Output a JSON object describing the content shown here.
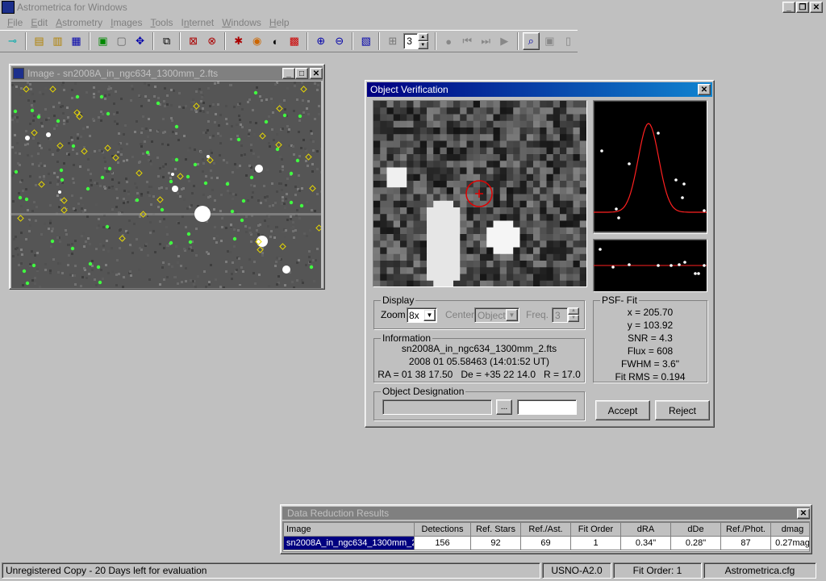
{
  "app": {
    "title": "Astrometrica for Windows"
  },
  "menu": [
    {
      "label": "File",
      "key": "F"
    },
    {
      "label": "Edit",
      "key": "E"
    },
    {
      "label": "Astrometry",
      "key": "A"
    },
    {
      "label": "Images",
      "key": "I"
    },
    {
      "label": "Tools",
      "key": "T"
    },
    {
      "label": "Internet",
      "key": "n"
    },
    {
      "label": "Windows",
      "key": "W"
    },
    {
      "label": "Help",
      "key": "H"
    }
  ],
  "toolbar": {
    "frame_count": "3"
  },
  "image_window": {
    "title": "Image - sn2008A_in_ngc634_1300mm_2.fts"
  },
  "verification": {
    "title": "Object Verification",
    "display": {
      "group_label": "Display",
      "zoom_label": "Zoom",
      "zoom_value": "8x",
      "center_label": "Center",
      "center_value": "Object",
      "freq_label": "Freq.",
      "freq_value": "3"
    },
    "info": {
      "group_label": "Information",
      "file": "sn2008A_in_ngc634_1300mm_2.fts",
      "date": "2008 01 05.58463 (14:01:52 UT)",
      "coords": "RA = 01 38 17.50   De = +35 22 14.0   R = 17.0"
    },
    "designation": {
      "group_label": "Object Designation",
      "browse_label": "..."
    },
    "psf": {
      "group_label": "PSF- Fit",
      "x": "x = 205.70",
      "y": "y = 103.92",
      "snr": "SNR = 4.3",
      "flux": "Flux = 608",
      "fwhm": "FWHM = 3.6\"",
      "rms": "Fit RMS = 0.194"
    },
    "accept_label": "Accept",
    "reject_label": "Reject"
  },
  "results": {
    "title": "Data Reduction Results",
    "columns": [
      "Image",
      "Detections",
      "Ref. Stars",
      "Ref./Ast.",
      "Fit Order",
      "dRA",
      "dDe",
      "Ref./Phot.",
      "dmag"
    ],
    "row": [
      "sn2008A_in_ngc634_1300mm_2.",
      "156",
      "92",
      "69",
      "1",
      "0.34\"",
      "0.28\"",
      "87",
      "0.27mag"
    ]
  },
  "status": {
    "message": "Unregistered Copy - 20 Days left for evaluation",
    "catalog": "USNO-A2.0",
    "fit_order": "Fit Order: 1",
    "config": "Astrometrica.cfg"
  },
  "colors": {
    "green_marker": "#40ff40",
    "yellow_marker": "#e8d800",
    "fit_curve": "#ff2020",
    "title_active": "#000080"
  }
}
